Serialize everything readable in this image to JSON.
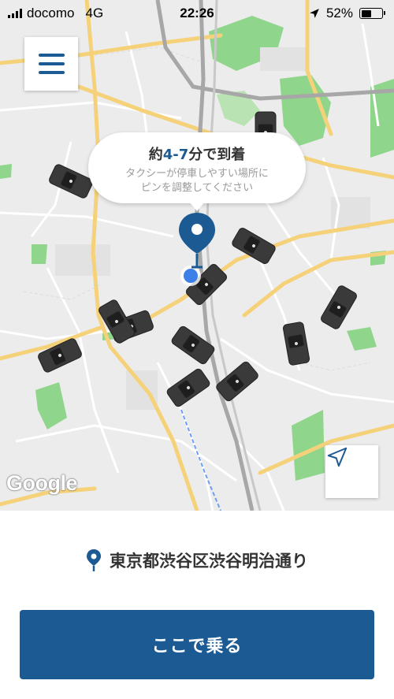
{
  "status_bar": {
    "carrier": "docomo",
    "network": "4G",
    "time": "22:26",
    "battery": "52%",
    "battery_level": 0.52,
    "location_icon": "location-arrow-icon"
  },
  "map": {
    "menu_icon": "hamburger-menu-icon",
    "eta": {
      "prefix": "約",
      "minutes": "4-7",
      "suffix": "分で到着",
      "hint_line1": "タクシーが停車しやすい場所に",
      "hint_line2": "ピンを調整してください"
    },
    "locate_icon": "navigation-arrow-icon",
    "attribution": "Google",
    "colors": {
      "pin": "#1c5a93",
      "user_dot": "#3d7fe8",
      "taxi": "#3a3a3a"
    }
  },
  "bottom_panel": {
    "address_icon": "pin-icon",
    "address": "東京都渋谷区渋谷明治通り",
    "ride_button": "ここで乗る",
    "accent": "#1c5a93"
  }
}
